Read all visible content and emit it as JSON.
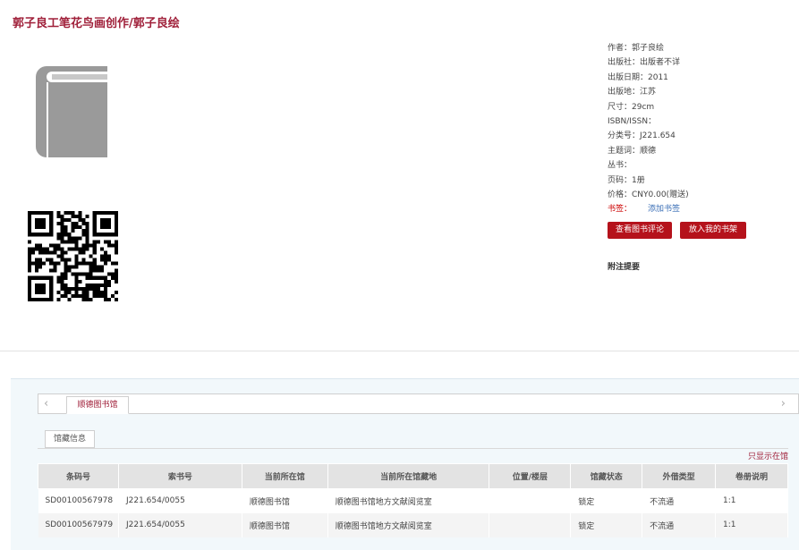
{
  "book": {
    "title": "郭子良工笔花鸟画创作/郭子良绘"
  },
  "meta": {
    "author": "作者：郭子良绘",
    "publisher": "出版社：出版者不详",
    "pub_date": "出版日期：2011",
    "pub_place": "出版地：江苏",
    "size": "尺寸：29cm",
    "isbn": "ISBN/ISSN：",
    "class_no": "分类号：J221.654",
    "subject": "主题词：顺德",
    "series": "丛书：",
    "pages": "页码：1册",
    "price": "价格：CNY0.00(赠送)",
    "tags_label": "书签：",
    "add_tag": "添加书签"
  },
  "buttons": {
    "review": "查看图书评论",
    "shelf": "放入我的书架"
  },
  "notes_label": "附注提要",
  "holdings": {
    "library_tab": "顺德图书馆",
    "info_tab": "馆藏信息",
    "only_show": "只显示在馆",
    "columns": [
      "条码号",
      "索书号",
      "当前所在馆",
      "当前所在馆藏地",
      "位置/楼层",
      "馆藏状态",
      "外借类型",
      "卷册说明"
    ],
    "rows": [
      [
        "SD00100567978",
        "J221.654/0055",
        "顺德图书馆",
        "顺德图书馆地方文献阅览室",
        "",
        "锁定",
        "不流通",
        "1:1"
      ],
      [
        "SD00100567979",
        "J221.654/0055",
        "顺德图书馆",
        "顺德图书馆地方文献阅览室",
        "",
        "锁定",
        "不流通",
        "1:1"
      ]
    ]
  },
  "colors": {
    "accent": "#a0203a",
    "button": "#b5121b",
    "link": "#3b6fb6"
  },
  "icons": [
    "book-cover-icon",
    "qr-code",
    "chevron-left-icon",
    "chevron-right-icon"
  ]
}
